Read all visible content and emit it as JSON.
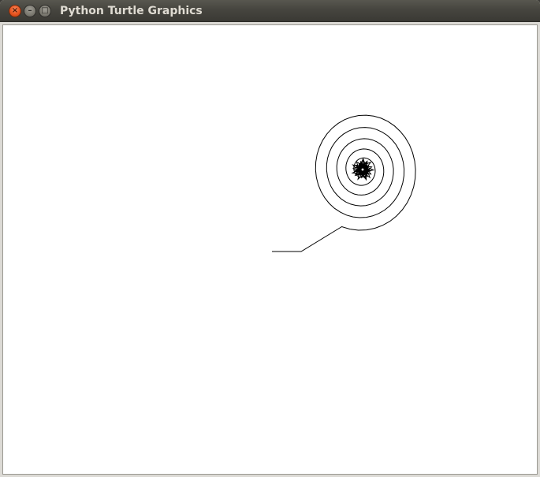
{
  "window": {
    "title": "Python Turtle Graphics"
  },
  "titlebar": {
    "buttons": [
      {
        "name": "close",
        "icon": "close-icon"
      },
      {
        "name": "minimize",
        "icon": "minimize-icon"
      },
      {
        "name": "maximize",
        "icon": "maximize-icon"
      }
    ]
  },
  "canvas": {
    "background": "#ffffff",
    "drawing": "spiral-path",
    "stroke_color": "#000000"
  }
}
